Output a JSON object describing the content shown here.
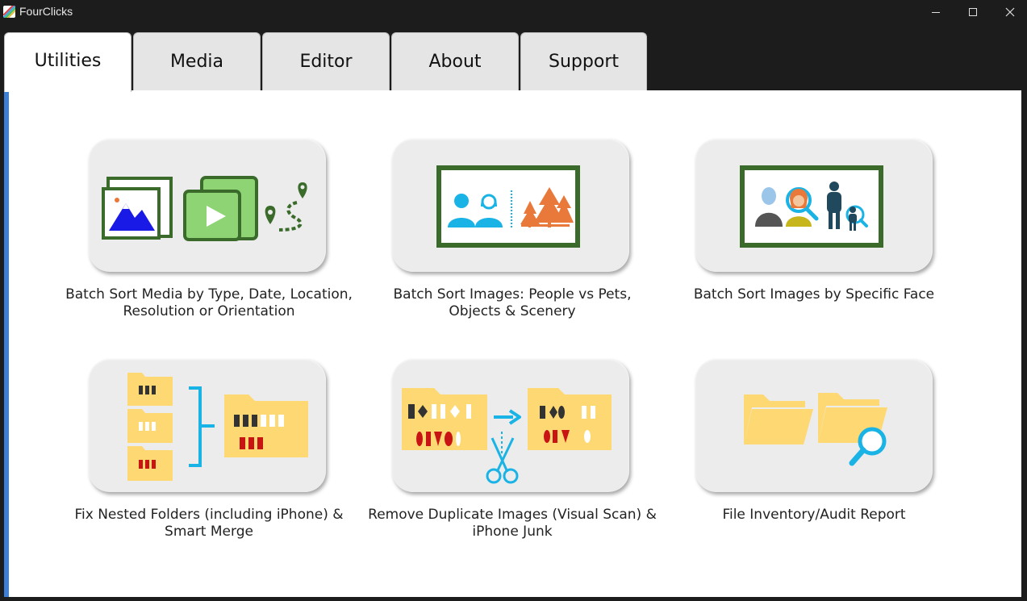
{
  "window": {
    "title": "FourClicks",
    "minimize_icon": "minimize-icon",
    "maximize_icon": "maximize-icon",
    "close_icon": "close-icon"
  },
  "tabs": [
    {
      "label": "Utilities",
      "active": true
    },
    {
      "label": "Media",
      "active": false
    },
    {
      "label": "Editor",
      "active": false
    },
    {
      "label": "About",
      "active": false
    },
    {
      "label": "Support",
      "active": false
    }
  ],
  "colors": {
    "accent": "#3b7fd9",
    "frame_green": "#3a6b2a",
    "light_green": "#8ed474",
    "blue": "#1a1ae6",
    "cyan": "#1ab3e6",
    "orange": "#e8793a",
    "folder_yellow": "#fdd873",
    "red": "#c91414",
    "dark": "#333333"
  },
  "utilities": [
    {
      "label_line1": "Batch Sort Media by Type, Date, Location,",
      "label_line2": "Resolution or Orientation",
      "icon": "media-sort-icon"
    },
    {
      "label_line1": "Batch Sort Images: People vs Pets,",
      "label_line2": "Objects & Scenery",
      "icon": "people-scenery-icon"
    },
    {
      "label_line1": "Batch Sort Images by Specific Face",
      "label_line2": "",
      "icon": "face-search-icon"
    },
    {
      "label_line1": "Fix Nested Folders (including iPhone) &",
      "label_line2": "Smart Merge",
      "icon": "nested-folders-icon"
    },
    {
      "label_line1": "Remove Duplicate Images (Visual Scan) &",
      "label_line2": "iPhone Junk",
      "icon": "duplicate-scissors-icon"
    },
    {
      "label_line1": "File Inventory/Audit Report",
      "label_line2": "",
      "icon": "folder-audit-icon"
    }
  ]
}
